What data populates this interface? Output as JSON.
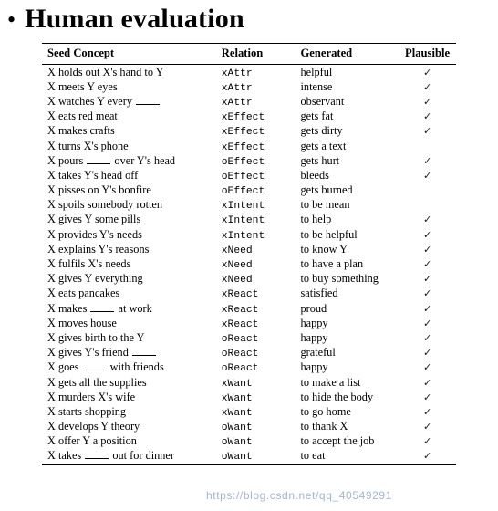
{
  "slide": {
    "bullet_glyph": "•",
    "title": "Human evaluation"
  },
  "table": {
    "headers": {
      "seed": "Seed Concept",
      "relation": "Relation",
      "generated": "Generated",
      "plausible": "Plausible"
    },
    "check_glyph": "✓",
    "rows": [
      {
        "seed_pre": "X holds out X's hand to Y",
        "seed_blank": false,
        "seed_post": "",
        "relation": "xAttr",
        "generated": "helpful",
        "plausible": true
      },
      {
        "seed_pre": "X meets Y eyes",
        "seed_blank": false,
        "seed_post": "",
        "relation": "xAttr",
        "generated": "intense",
        "plausible": true
      },
      {
        "seed_pre": "X watches Y every ",
        "seed_blank": true,
        "seed_post": "",
        "relation": "xAttr",
        "generated": "observant",
        "plausible": true
      },
      {
        "seed_pre": "X eats red meat",
        "seed_blank": false,
        "seed_post": "",
        "relation": "xEffect",
        "generated": "gets fat",
        "plausible": true
      },
      {
        "seed_pre": "X makes crafts",
        "seed_blank": false,
        "seed_post": "",
        "relation": "xEffect",
        "generated": "gets dirty",
        "plausible": true
      },
      {
        "seed_pre": "X turns X's phone",
        "seed_blank": false,
        "seed_post": "",
        "relation": "xEffect",
        "generated": "gets a text",
        "plausible": false
      },
      {
        "seed_pre": "X pours ",
        "seed_blank": true,
        "seed_post": " over Y's head",
        "relation": "oEffect",
        "generated": "gets hurt",
        "plausible": true
      },
      {
        "seed_pre": "X takes Y's head off",
        "seed_blank": false,
        "seed_post": "",
        "relation": "oEffect",
        "generated": "bleeds",
        "plausible": true
      },
      {
        "seed_pre": "X pisses on Y's bonfire",
        "seed_blank": false,
        "seed_post": "",
        "relation": "oEffect",
        "generated": "gets burned",
        "plausible": false
      },
      {
        "seed_pre": "X spoils somebody rotten",
        "seed_blank": false,
        "seed_post": "",
        "relation": "xIntent",
        "generated": "to be mean",
        "plausible": false
      },
      {
        "seed_pre": "X gives Y some pills",
        "seed_blank": false,
        "seed_post": "",
        "relation": "xIntent",
        "generated": "to help",
        "plausible": true
      },
      {
        "seed_pre": "X provides Y's needs",
        "seed_blank": false,
        "seed_post": "",
        "relation": "xIntent",
        "generated": "to be helpful",
        "plausible": true
      },
      {
        "seed_pre": "X explains Y's reasons",
        "seed_blank": false,
        "seed_post": "",
        "relation": "xNeed",
        "generated": "to know Y",
        "plausible": true
      },
      {
        "seed_pre": "X fulfils X's needs",
        "seed_blank": false,
        "seed_post": "",
        "relation": "xNeed",
        "generated": "to have a plan",
        "plausible": true
      },
      {
        "seed_pre": "X gives Y everything",
        "seed_blank": false,
        "seed_post": "",
        "relation": "xNeed",
        "generated": "to buy something",
        "plausible": true
      },
      {
        "seed_pre": "X eats pancakes",
        "seed_blank": false,
        "seed_post": "",
        "relation": "xReact",
        "generated": "satisfied",
        "plausible": true
      },
      {
        "seed_pre": "X makes ",
        "seed_blank": true,
        "seed_post": " at work",
        "relation": "xReact",
        "generated": "proud",
        "plausible": true
      },
      {
        "seed_pre": "X moves house",
        "seed_blank": false,
        "seed_post": "",
        "relation": "xReact",
        "generated": "happy",
        "plausible": true
      },
      {
        "seed_pre": "X gives birth to the Y",
        "seed_blank": false,
        "seed_post": "",
        "relation": "oReact",
        "generated": "happy",
        "plausible": true
      },
      {
        "seed_pre": "X gives Y's friend ",
        "seed_blank": true,
        "seed_post": "",
        "relation": "oReact",
        "generated": "grateful",
        "plausible": true
      },
      {
        "seed_pre": "X goes ",
        "seed_blank": true,
        "seed_post": " with friends",
        "relation": "oReact",
        "generated": "happy",
        "plausible": true
      },
      {
        "seed_pre": "X gets all the supplies",
        "seed_blank": false,
        "seed_post": "",
        "relation": "xWant",
        "generated": "to make a list",
        "plausible": true
      },
      {
        "seed_pre": "X murders X's wife",
        "seed_blank": false,
        "seed_post": "",
        "relation": "xWant",
        "generated": "to hide the body",
        "plausible": true
      },
      {
        "seed_pre": "X starts shopping",
        "seed_blank": false,
        "seed_post": "",
        "relation": "xWant",
        "generated": "to go home",
        "plausible": true
      },
      {
        "seed_pre": "X develops Y theory",
        "seed_blank": false,
        "seed_post": "",
        "relation": "oWant",
        "generated": "to thank X",
        "plausible": true
      },
      {
        "seed_pre": "X offer Y a position",
        "seed_blank": false,
        "seed_post": "",
        "relation": "oWant",
        "generated": "to accept the job",
        "plausible": true
      },
      {
        "seed_pre": "X takes ",
        "seed_blank": true,
        "seed_post": " out for dinner",
        "relation": "oWant",
        "generated": "to eat",
        "plausible": true
      }
    ]
  },
  "watermark": {
    "text_a": "https://blog.csdn.net/qq_",
    "text_b": "40549291"
  }
}
